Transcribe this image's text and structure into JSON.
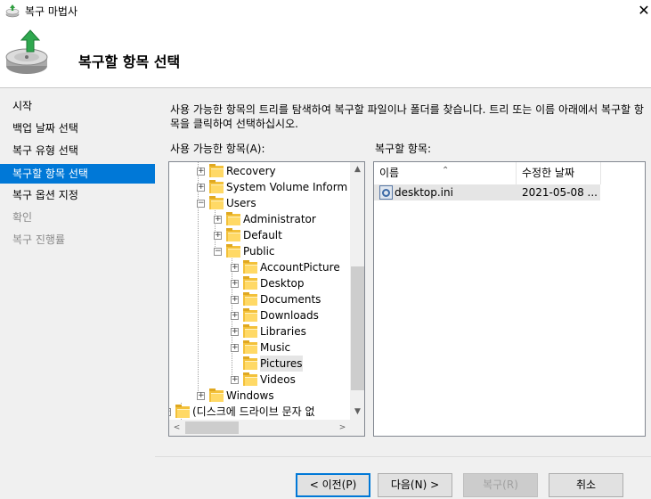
{
  "window": {
    "title": "복구 마법사",
    "close_glyph": "✕"
  },
  "header": {
    "title": "복구할 항목 선택"
  },
  "sidebar": {
    "steps": [
      {
        "label": "시작",
        "state": "normal"
      },
      {
        "label": "백업 날짜 선택",
        "state": "normal"
      },
      {
        "label": "복구 유형 선택",
        "state": "normal"
      },
      {
        "label": "복구할 항목 선택",
        "state": "active"
      },
      {
        "label": "복구 옵션 지정",
        "state": "normal"
      },
      {
        "label": "확인",
        "state": "disabled"
      },
      {
        "label": "복구 진행률",
        "state": "disabled"
      }
    ]
  },
  "main": {
    "description": "사용 가능한 항목의 트리를 탐색하여 복구할 파일이나 폴더를 찾습니다. 트리 또는 이름 아래에서 복구할 항목을 클릭하여 선택하십시오.",
    "available_label": "사용 가능한 항목(A):",
    "restore_label": "복구할 항목:",
    "tree": [
      {
        "label": "Recovery",
        "depth": 1,
        "expander": "+"
      },
      {
        "label": "System Volume Inform",
        "depth": 1,
        "expander": "+"
      },
      {
        "label": "Users",
        "depth": 1,
        "expander": "−"
      },
      {
        "label": "Administrator",
        "depth": 2,
        "expander": "+"
      },
      {
        "label": "Default",
        "depth": 2,
        "expander": "+"
      },
      {
        "label": "Public",
        "depth": 2,
        "expander": "−"
      },
      {
        "label": "AccountPicture",
        "depth": 3,
        "expander": "+"
      },
      {
        "label": "Desktop",
        "depth": 3,
        "expander": "+"
      },
      {
        "label": "Documents",
        "depth": 3,
        "expander": "+"
      },
      {
        "label": "Downloads",
        "depth": 3,
        "expander": "+"
      },
      {
        "label": "Libraries",
        "depth": 3,
        "expander": "+"
      },
      {
        "label": "Music",
        "depth": 3,
        "expander": "+"
      },
      {
        "label": "Pictures",
        "depth": 3,
        "expander": "",
        "selected": true
      },
      {
        "label": "Videos",
        "depth": 3,
        "expander": "+"
      },
      {
        "label": "Windows",
        "depth": 1,
        "expander": "+"
      },
      {
        "label": "(디스크에 드라이브 문자 없",
        "depth": 0,
        "expander": "−"
      }
    ],
    "list": {
      "columns": {
        "name": "이름",
        "date": "수정한 날짜"
      },
      "sort_glyph": "⌃",
      "rows": [
        {
          "name": "desktop.ini",
          "date": "2021-05-08 ..."
        }
      ]
    },
    "scroll_glyphs": {
      "up": "▲",
      "down": "▼",
      "left": "<",
      "right": ">"
    }
  },
  "buttons": {
    "back": "< 이전(P)",
    "next": "다음(N) >",
    "restore": "복구(R)",
    "cancel": "취소"
  }
}
